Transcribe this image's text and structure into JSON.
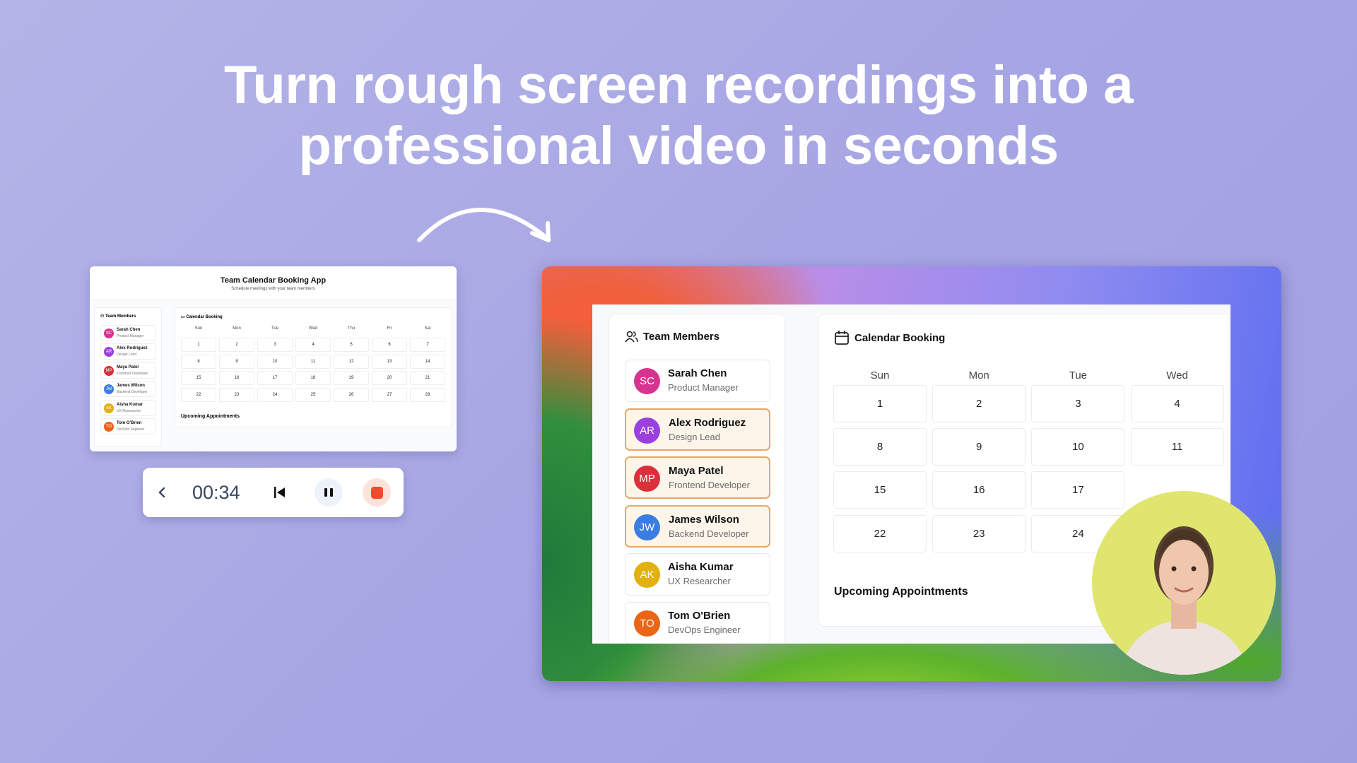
{
  "headline": {
    "line1": "Turn rough screen recordings into a",
    "line2": "professional video in seconds"
  },
  "small_preview": {
    "title": "Team Calendar Booking App",
    "subtitle": "Schedule meetings with your team members",
    "team_title": "Team Members",
    "calendar_title": "Calendar Booking",
    "days": [
      "Sun",
      "Mon",
      "Tue",
      "Wed",
      "Thu",
      "Fri",
      "Sat"
    ],
    "dates": [
      1,
      2,
      3,
      4,
      5,
      6,
      7,
      8,
      9,
      10,
      11,
      12,
      13,
      14,
      15,
      16,
      17,
      18,
      19,
      20,
      21,
      22,
      23,
      24,
      25,
      26,
      27,
      28
    ],
    "upcoming": "Upcoming Appointments"
  },
  "recorder": {
    "time": "00:34",
    "back_icon": "chevron-left-icon",
    "restart_icon": "skip-back-icon",
    "pause_icon": "pause-icon",
    "stop_icon": "stop-icon",
    "stop_color": "#f2492a"
  },
  "app": {
    "team_title": "Team Members",
    "calendar_title": "Calendar Booking",
    "days": [
      "Sun",
      "Mon",
      "Tue",
      "Wed"
    ],
    "dates": [
      [
        1,
        2,
        3,
        4
      ],
      [
        8,
        9,
        10,
        11
      ],
      [
        15,
        16,
        17,
        ""
      ],
      [
        22,
        23,
        24,
        ""
      ]
    ],
    "upcoming": "Upcoming Appointments"
  },
  "members": [
    {
      "initials": "SC",
      "name": "Sarah Chen",
      "role": "Product Manager",
      "color": "#d6348f",
      "selected": false
    },
    {
      "initials": "AR",
      "name": "Alex Rodriguez",
      "role": "Design Lead",
      "color": "#9b3fe0",
      "selected": true
    },
    {
      "initials": "MP",
      "name": "Maya Patel",
      "role": "Frontend Developer",
      "color": "#dc2f3c",
      "selected": true
    },
    {
      "initials": "JW",
      "name": "James Wilson",
      "role": "Backend Developer",
      "color": "#3a7de0",
      "selected": true
    },
    {
      "initials": "AK",
      "name": "Aisha Kumar",
      "role": "UX Researcher",
      "color": "#e2b10e",
      "selected": false
    },
    {
      "initials": "TO",
      "name": "Tom O'Brien",
      "role": "DevOps Engineer",
      "color": "#ea6516",
      "selected": false
    }
  ],
  "webcam": {
    "background": "#dfe56f"
  }
}
